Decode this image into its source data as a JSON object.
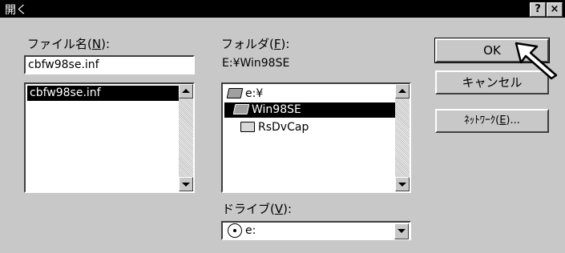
{
  "window": {
    "title": "開く",
    "help_label": "?",
    "close_label": "×"
  },
  "filename": {
    "label": "ファイル名(",
    "accel": "N",
    "label_end": "):",
    "value": "cbfw98se.inf",
    "list": [
      "cbfw98se.inf"
    ]
  },
  "folder": {
    "label": "フォルダ(",
    "accel": "F",
    "label_end": "):",
    "path": "E:¥Win98SE",
    "tree": [
      {
        "label": "e:¥",
        "icon": "open-folder-icon",
        "selected": false,
        "indent": 0
      },
      {
        "label": "Win98SE",
        "icon": "open-folder-icon",
        "selected": true,
        "indent": 1
      },
      {
        "label": "RsDvCap",
        "icon": "folder-icon",
        "selected": false,
        "indent": 2
      }
    ]
  },
  "drive": {
    "label": "ドライブ(",
    "accel": "V",
    "label_end": "):",
    "value": "e:"
  },
  "buttons": {
    "ok": "OK",
    "cancel": "キャンセル",
    "network_prefix": "ﾈｯﾄﾜｰｸ(",
    "network_accel": "E",
    "network_suffix": ")..."
  },
  "colors": {
    "face": "#c8c8c8",
    "selection": "#000000",
    "titlebar": "#000000"
  }
}
